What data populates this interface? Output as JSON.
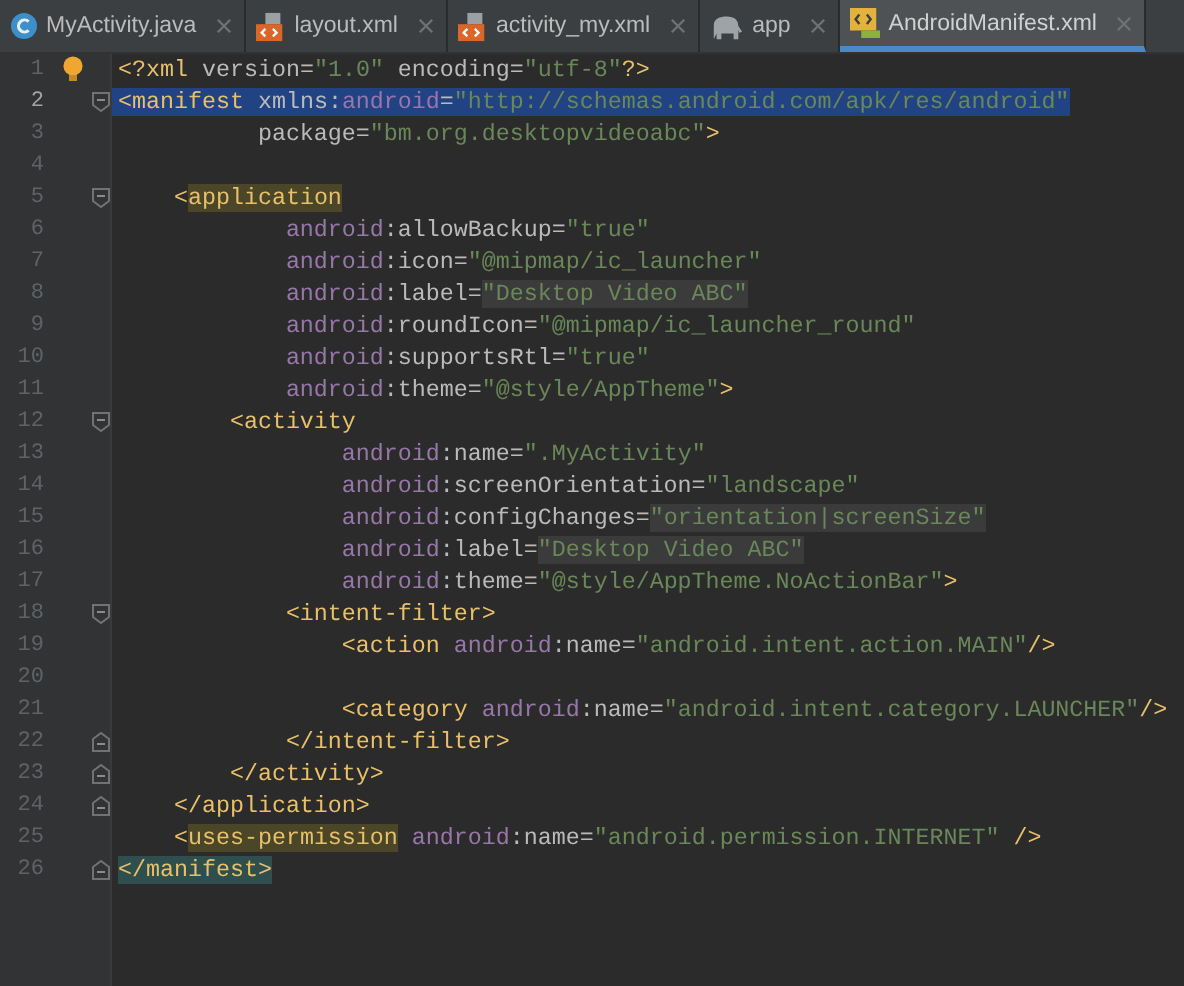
{
  "tabs": [
    {
      "label": "MyActivity.java",
      "kind": "class",
      "selected": false
    },
    {
      "label": "layout.xml",
      "kind": "layout",
      "selected": false
    },
    {
      "label": "activity_my.xml",
      "kind": "layout",
      "selected": false
    },
    {
      "label": "app",
      "kind": "gradle",
      "selected": false
    },
    {
      "label": "AndroidManifest.xml",
      "kind": "manifest",
      "selected": true
    }
  ],
  "editor": {
    "lines": [
      {
        "number": "1",
        "selected": false,
        "fold_start": false,
        "fold_end": false,
        "bulb": true,
        "tokens": [
          {
            "text": "<?xml",
            "kind": "tag"
          },
          {
            "text": " version=",
            "kind": "attr"
          },
          {
            "text": "\"1.0\"",
            "kind": "value"
          },
          {
            "text": " encoding=",
            "kind": "attr"
          },
          {
            "text": "\"utf-8\"",
            "kind": "value"
          },
          {
            "text": "?>",
            "kind": "tag"
          }
        ]
      },
      {
        "number": "2",
        "selected": true,
        "fold_start": true,
        "fold_end": false,
        "bulb": false,
        "tokens": [
          {
            "text": "<manifest",
            "kind": "tag"
          },
          {
            "text": " xmlns:",
            "kind": "attr"
          },
          {
            "text": "android",
            "kind": "ns"
          },
          {
            "text": "=",
            "kind": "attr"
          },
          {
            "text": "\"http://schemas.android.com/apk/res/android\"",
            "kind": "value"
          }
        ]
      },
      {
        "number": "3",
        "selected": false,
        "fold_start": false,
        "fold_end": false,
        "bulb": false,
        "tokens": [
          {
            "text": "          package=",
            "kind": "attr"
          },
          {
            "text": "\"bm.org.desktopvideoabc\"",
            "kind": "value"
          },
          {
            "text": ">",
            "kind": "tag"
          }
        ]
      },
      {
        "number": "4",
        "selected": false,
        "fold_start": false,
        "fold_end": false,
        "bulb": false
      },
      {
        "number": "5",
        "selected": false,
        "fold_start": true,
        "fold_end": false,
        "bulb": false,
        "tokens": [
          {
            "text": "    <",
            "kind": "tag"
          },
          {
            "text": "application",
            "kind": "match"
          }
        ]
      },
      {
        "number": "6",
        "selected": false,
        "fold_start": false,
        "fold_end": false,
        "bulb": false,
        "tokens": [
          {
            "text": "            android",
            "kind": "ns"
          },
          {
            "text": ":allowBackup=",
            "kind": "attr"
          },
          {
            "text": "\"true\"",
            "kind": "value"
          }
        ]
      },
      {
        "number": "7",
        "selected": false,
        "fold_start": false,
        "fold_end": false,
        "bulb": false,
        "tokens": [
          {
            "text": "            android",
            "kind": "ns"
          },
          {
            "text": ":icon=",
            "kind": "attr"
          },
          {
            "text": "\"@mipmap/ic_launcher\"",
            "kind": "value"
          }
        ]
      },
      {
        "number": "8",
        "selected": false,
        "fold_start": false,
        "fold_end": false,
        "bulb": false,
        "tokens": [
          {
            "text": "            android",
            "kind": "ns"
          },
          {
            "text": ":label=",
            "kind": "attr"
          },
          {
            "text": "\"Desktop Video ABC\"",
            "kind": "literal"
          }
        ]
      },
      {
        "number": "9",
        "selected": false,
        "fold_start": false,
        "fold_end": false,
        "bulb": false,
        "tokens": [
          {
            "text": "            android",
            "kind": "ns"
          },
          {
            "text": ":roundIcon=",
            "kind": "attr"
          },
          {
            "text": "\"@mipmap/ic_launcher_round\"",
            "kind": "value"
          }
        ]
      },
      {
        "number": "10",
        "selected": false,
        "fold_start": false,
        "fold_end": false,
        "bulb": false,
        "tokens": [
          {
            "text": "            android",
            "kind": "ns"
          },
          {
            "text": ":supportsRtl=",
            "kind": "attr"
          },
          {
            "text": "\"true\"",
            "kind": "value"
          }
        ]
      },
      {
        "number": "11",
        "selected": false,
        "fold_start": false,
        "fold_end": false,
        "bulb": false,
        "tokens": [
          {
            "text": "            android",
            "kind": "ns"
          },
          {
            "text": ":theme=",
            "kind": "attr"
          },
          {
            "text": "\"@style/AppTheme\"",
            "kind": "value"
          },
          {
            "text": ">",
            "kind": "tag"
          }
        ]
      },
      {
        "number": "12",
        "selected": false,
        "fold_start": true,
        "fold_end": false,
        "bulb": false,
        "tokens": [
          {
            "text": "        <activity",
            "kind": "tag"
          }
        ]
      },
      {
        "number": "13",
        "selected": false,
        "fold_start": false,
        "fold_end": false,
        "bulb": false,
        "tokens": [
          {
            "text": "                android",
            "kind": "ns"
          },
          {
            "text": ":name=",
            "kind": "attr"
          },
          {
            "text": "\".MyActivity\"",
            "kind": "value"
          }
        ]
      },
      {
        "number": "14",
        "selected": false,
        "fold_start": false,
        "fold_end": false,
        "bulb": false,
        "tokens": [
          {
            "text": "                android",
            "kind": "ns"
          },
          {
            "text": ":screenOrientation=",
            "kind": "attr"
          },
          {
            "text": "\"landscape\"",
            "kind": "value"
          }
        ]
      },
      {
        "number": "15",
        "selected": false,
        "fold_start": false,
        "fold_end": false,
        "bulb": false,
        "tokens": [
          {
            "text": "                android",
            "kind": "ns"
          },
          {
            "text": ":configChanges=",
            "kind": "attr"
          },
          {
            "text": "\"orientation|screenSize\"",
            "kind": "literal"
          }
        ]
      },
      {
        "number": "16",
        "selected": false,
        "fold_start": false,
        "fold_end": false,
        "bulb": false,
        "tokens": [
          {
            "text": "                android",
            "kind": "ns"
          },
          {
            "text": ":label=",
            "kind": "attr"
          },
          {
            "text": "\"Desktop Video ABC\"",
            "kind": "literal"
          }
        ]
      },
      {
        "number": "17",
        "selected": false,
        "fold_start": false,
        "fold_end": false,
        "bulb": false,
        "tokens": [
          {
            "text": "                android",
            "kind": "ns"
          },
          {
            "text": ":theme=",
            "kind": "attr"
          },
          {
            "text": "\"@style/AppTheme.NoActionBar\"",
            "kind": "value"
          },
          {
            "text": ">",
            "kind": "tag"
          }
        ]
      },
      {
        "number": "18",
        "selected": false,
        "fold_start": true,
        "fold_end": false,
        "bulb": false,
        "tokens": [
          {
            "text": "            <intent-filter>",
            "kind": "tag"
          }
        ]
      },
      {
        "number": "19",
        "selected": false,
        "fold_start": false,
        "fold_end": false,
        "bulb": false,
        "tokens": [
          {
            "text": "                <action ",
            "kind": "tag"
          },
          {
            "text": "android",
            "kind": "ns"
          },
          {
            "text": ":name=",
            "kind": "attr"
          },
          {
            "text": "\"android.intent.action.MAIN\"",
            "kind": "value"
          },
          {
            "text": "/>",
            "kind": "tag"
          }
        ]
      },
      {
        "number": "20",
        "selected": false,
        "fold_start": false,
        "fold_end": false,
        "bulb": false
      },
      {
        "number": "21",
        "selected": false,
        "fold_start": false,
        "fold_end": false,
        "bulb": false,
        "tokens": [
          {
            "text": "                <category ",
            "kind": "tag"
          },
          {
            "text": "android",
            "kind": "ns"
          },
          {
            "text": ":name=",
            "kind": "attr"
          },
          {
            "text": "\"android.intent.category.LAUNCHER\"",
            "kind": "value"
          },
          {
            "text": "/>",
            "kind": "tag"
          }
        ]
      },
      {
        "number": "22",
        "selected": false,
        "fold_start": false,
        "fold_end": true,
        "bulb": false,
        "tokens": [
          {
            "text": "            </intent-filter>",
            "kind": "tag"
          }
        ]
      },
      {
        "number": "23",
        "selected": false,
        "fold_start": false,
        "fold_end": true,
        "bulb": false,
        "tokens": [
          {
            "text": "        </activity>",
            "kind": "tag"
          }
        ]
      },
      {
        "number": "24",
        "selected": false,
        "fold_start": false,
        "fold_end": true,
        "bulb": false,
        "tokens": [
          {
            "text": "    </application>",
            "kind": "tag"
          }
        ]
      },
      {
        "number": "25",
        "selected": false,
        "fold_start": false,
        "fold_end": false,
        "bulb": false,
        "tokens": [
          {
            "text": "    <",
            "kind": "tag"
          },
          {
            "text": "uses-permission",
            "kind": "match"
          },
          {
            "text": " android",
            "kind": "ns"
          },
          {
            "text": ":name=",
            "kind": "attr"
          },
          {
            "text": "\"android.permission.INTERNET\"",
            "kind": "value"
          },
          {
            "text": " />",
            "kind": "tag"
          }
        ]
      },
      {
        "number": "26",
        "selected": false,
        "fold_start": false,
        "fold_end": true,
        "bulb": false,
        "tokens": [
          {
            "text": "</manifest>",
            "kind": "brace"
          }
        ]
      }
    ]
  }
}
